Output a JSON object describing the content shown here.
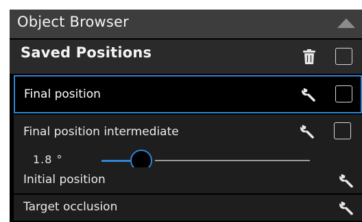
{
  "panel": {
    "title": "Object Browser",
    "collapse_icon": "triangle-up-icon"
  },
  "saved_positions": {
    "header_label": "Saved Positions",
    "header_icon": "trash-icon",
    "items": [
      {
        "label": "Final position",
        "selected": true,
        "icon": "wrench-icon",
        "has_checkbox": true
      },
      {
        "label": "Final position intermediate",
        "selected": false,
        "icon": "wrench-icon",
        "has_checkbox": true,
        "slider": {
          "value_text": "1.8 °",
          "fraction": 0.19
        }
      },
      {
        "label": "Initial position",
        "selected": false,
        "icon": "wrench-icon",
        "has_checkbox": false
      },
      {
        "label": "Target occlusion",
        "selected": false,
        "icon": "wrench-icon",
        "has_checkbox": false
      }
    ]
  },
  "colors": {
    "accent": "#2f86d6",
    "title_bar": "#3d3d3d",
    "header_bar": "#2a2a2a",
    "row_bg": "#1e1e1e",
    "panel_bg": "#000000"
  }
}
